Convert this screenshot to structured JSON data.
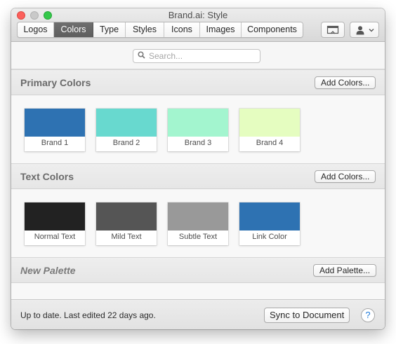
{
  "window": {
    "title": "Brand.ai: Style"
  },
  "tabs": [
    {
      "label": "Logos",
      "active": false
    },
    {
      "label": "Colors",
      "active": true
    },
    {
      "label": "Type",
      "active": false
    },
    {
      "label": "Styles",
      "active": false
    },
    {
      "label": "Icons",
      "active": false
    },
    {
      "label": "Images",
      "active": false
    },
    {
      "label": "Components",
      "active": false
    }
  ],
  "toolbar": {
    "present_icon": "present-icon",
    "user_icon": "user-icon",
    "chevron_icon": "chevron-down-icon"
  },
  "search": {
    "placeholder": "Search...",
    "value": ""
  },
  "sections": [
    {
      "title": "Primary Colors",
      "button": "Add Colors...",
      "swatches": [
        {
          "label": "Brand 1",
          "color": "#2e72b2"
        },
        {
          "label": "Brand 2",
          "color": "#68d9cf"
        },
        {
          "label": "Brand 3",
          "color": "#a3f5cf"
        },
        {
          "label": "Brand 4",
          "color": "#e5fdc0"
        }
      ]
    },
    {
      "title": "Text Colors",
      "button": "Add Colors...",
      "swatches": [
        {
          "label": "Normal Text",
          "color": "#222222"
        },
        {
          "label": "Mild Text",
          "color": "#555555"
        },
        {
          "label": "Subtle Text",
          "color": "#999999"
        },
        {
          "label": "Link Color",
          "color": "#2e72b2"
        }
      ]
    },
    {
      "title": "New Palette",
      "button": "Add Palette...",
      "swatches": []
    }
  ],
  "footer": {
    "status": "Up to date. Last edited 22 days ago.",
    "sync_label": "Sync to Document",
    "help_label": "?"
  }
}
